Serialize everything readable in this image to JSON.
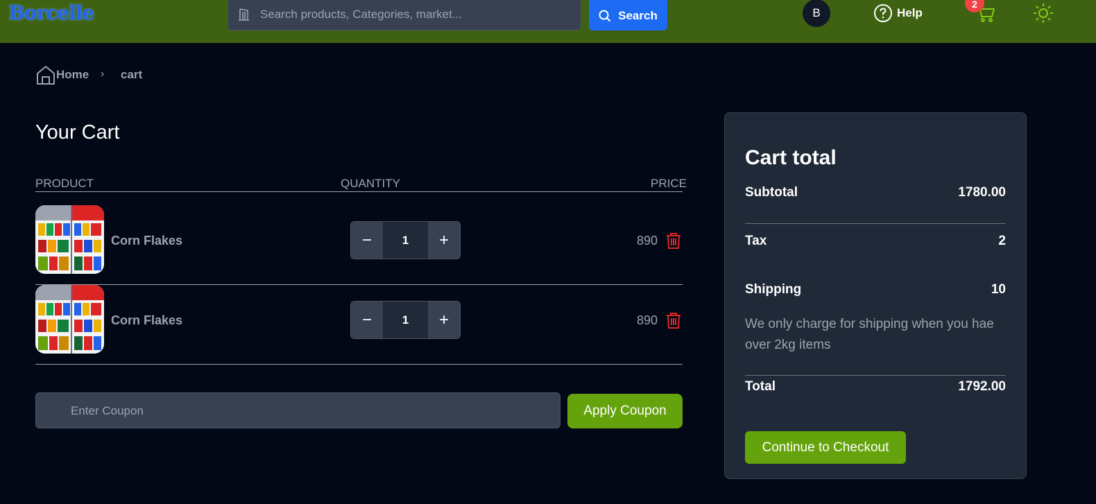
{
  "header": {
    "logo_text": "Borcelle",
    "search": {
      "placeholder": "Search products, Categories, market...",
      "value": ""
    },
    "search_button_label": "Search",
    "avatar_initial": "B",
    "help_label": "Help",
    "cart_count": "2",
    "colors": {
      "bar": "#3f6212",
      "accent": "#1d6bf3",
      "badge": "#ef4444"
    }
  },
  "breadcrumb": {
    "home": "Home",
    "separator": "›",
    "current": "cart"
  },
  "cart": {
    "title": "Your Cart",
    "columns": {
      "product": "PRODUCT",
      "quantity": "QUANTITY",
      "price": "PRICE"
    },
    "items": [
      {
        "name": "Corn Flakes",
        "quantity": "1",
        "price": "890",
        "minus": "−",
        "plus": "+"
      },
      {
        "name": "Corn Flakes",
        "quantity": "1",
        "price": "890",
        "minus": "−",
        "plus": "+"
      }
    ],
    "coupon": {
      "placeholder": "Enter Coupon",
      "value": ""
    },
    "apply_label": "Apply Coupon"
  },
  "summary": {
    "title": "Cart total",
    "subtotal_label": "Subtotal",
    "subtotal_value": "1780.00",
    "tax_label": "Tax",
    "tax_value": "2",
    "shipping_label": "Shipping",
    "shipping_value": "10",
    "shipping_note": "We only charge for shipping when you hae over 2kg items",
    "total_label": "Total",
    "total_value": "1792.00",
    "checkout_label": "Continue to Checkout",
    "colors": {
      "button": "#65a30d"
    }
  }
}
